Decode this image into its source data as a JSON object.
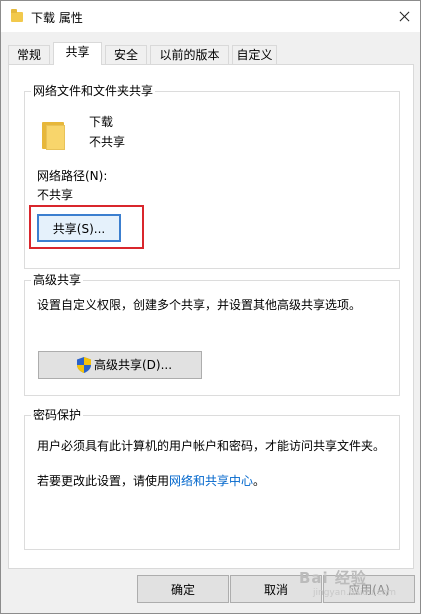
{
  "window": {
    "title": "下载 属性",
    "close_glyph": ""
  },
  "tabs": [
    {
      "label": "常规"
    },
    {
      "label": "共享"
    },
    {
      "label": "安全"
    },
    {
      "label": "以前的版本"
    },
    {
      "label": "自定义"
    }
  ],
  "network_share": {
    "group_title": "网络文件和文件夹共享",
    "folder_name": "下载",
    "share_status": "不共享",
    "path_label": "网络路径(N):",
    "path_value": "不共享",
    "share_button": "共享(S)..."
  },
  "advanced_share": {
    "group_title": "高级共享",
    "description": "设置自定义权限，创建多个共享，并设置其他高级共享选项。",
    "button": "高级共享(D)..."
  },
  "password_protection": {
    "group_title": "密码保护",
    "description": "用户必须具有此计算机的用户帐户和密码，才能访问共享文件夹。",
    "change_prefix": "若要更改此设置，请使用",
    "change_link": "网络和共享中心",
    "change_suffix": "。"
  },
  "footer": {
    "ok": "确定",
    "cancel": "取消",
    "apply": "应用(A)"
  },
  "watermark": {
    "text": "Bai 经验",
    "sub": "jingyan.baidu.com"
  },
  "colors": {
    "accent_focus": "#3c7fcf",
    "annotation_red": "#d9262c",
    "link": "#0066cc"
  }
}
